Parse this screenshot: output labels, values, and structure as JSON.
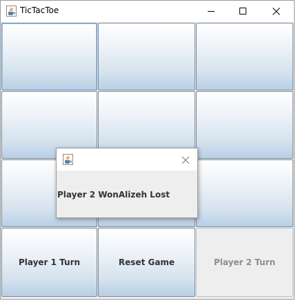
{
  "window": {
    "title": "TicTacToe",
    "app_icon": "java-cup-icon",
    "controls": [
      "minimize-icon",
      "maximize-icon",
      "close-icon"
    ]
  },
  "board": {
    "cells": [
      "",
      "",
      "",
      "",
      "",
      "",
      "",
      "",
      ""
    ]
  },
  "controls": {
    "player1_label": "Player 1 Turn",
    "reset_label": "Reset Game",
    "player2_label": "Player 2 Turn"
  },
  "dialog": {
    "title": "",
    "icon": "java-cup-icon",
    "message": "Player 2 WonAlizeh Lost"
  },
  "colors": {
    "button_gradient_top": "#ffffff",
    "button_gradient_bottom": "#b8cfe5",
    "button_border": "#7a8a99",
    "disabled_text": "#8d8d8d"
  }
}
